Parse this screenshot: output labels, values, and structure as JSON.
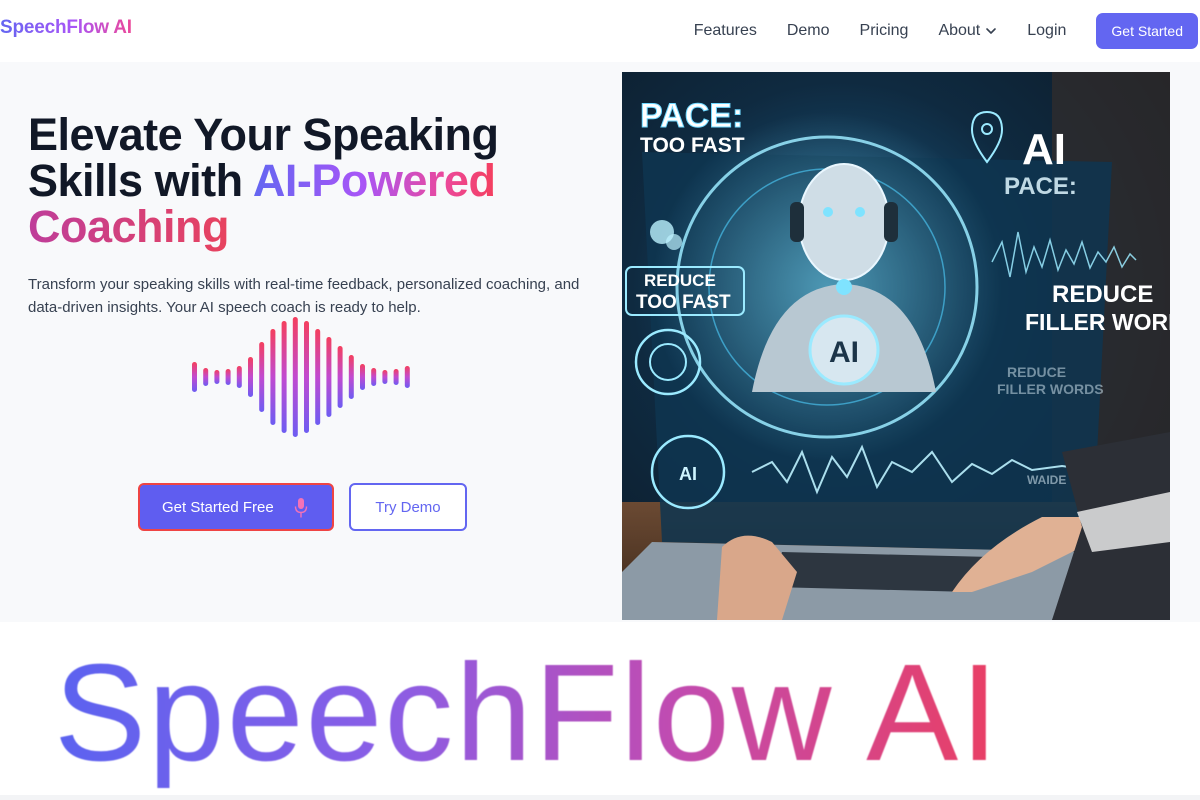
{
  "nav": {
    "brand": "SpeechFlow AI",
    "links": [
      "Features",
      "Demo",
      "Pricing",
      "About",
      "Login"
    ],
    "cta": "Get Started"
  },
  "hero": {
    "headline_line1": "Elevate Your Speaking",
    "headline_line2_plain": "Skills with ",
    "headline_line2_grad": "AI-Powered",
    "headline_line3": "Coaching",
    "subtitle": "Transform your speaking skills with real-time feedback, personalized coaching, and data-driven insights. Your AI speech coach is ready to help.",
    "primary_button": "Get Started Free",
    "secondary_button": "Try Demo",
    "image_labels": {
      "pace_title": "PACE:",
      "pace_sub": "TOO FAST",
      "reduce_1": "REDUCE",
      "reduce_2": "TOO FAST",
      "ai_big": "AI",
      "pace_right": "PACE:",
      "filler_1": "REDUCE",
      "filler_2": "FILLER WORDS",
      "ai_center": "AI",
      "ai_small": "AI",
      "faded_1": "REDUCE",
      "faded_2": "FILLER WORDS",
      "wave_label": "WAIDE"
    }
  },
  "big_logo": "SpeechFlow AI",
  "icons": {
    "about_chevron": "chevron-down-icon",
    "mic": "microphone-icon"
  },
  "colors": {
    "primary": "#6366f1",
    "accent_pink": "#ec4899",
    "accent_red": "#f43f5e"
  }
}
